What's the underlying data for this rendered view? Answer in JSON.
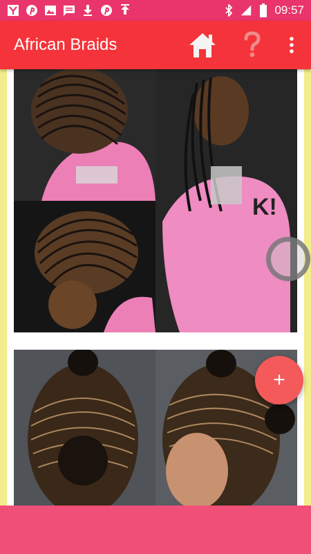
{
  "status_bar": {
    "time": "09:57",
    "left_icons": [
      "yahoo-icon",
      "pinterest-icon",
      "image-icon",
      "message-icon",
      "download-icon",
      "pinterest-icon",
      "upload-icon"
    ],
    "right_icons": [
      "bluetooth-icon",
      "signal-icon",
      "battery-icon"
    ]
  },
  "app_bar": {
    "title": "African Braids",
    "actions": [
      "home-icon",
      "help-icon",
      "more-vert-icon"
    ]
  },
  "fab": {
    "label": "+"
  },
  "colors": {
    "status_bar": "#e9356b",
    "app_bar": "#f5333a",
    "fab": "#f45a5a",
    "bottom_bar": "#f04f78",
    "side_background": "#f2ec8a",
    "home_icon": "#f4f4f4",
    "help_icon": "#f08a8a"
  }
}
